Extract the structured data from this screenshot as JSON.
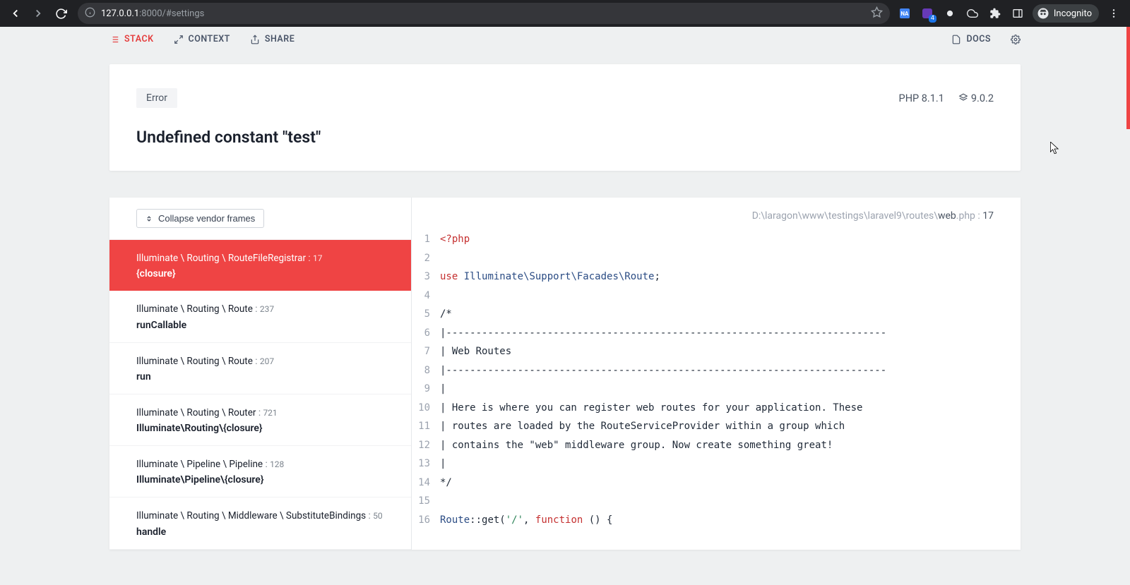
{
  "browser": {
    "url_host": "127.0.0.1",
    "url_port": ":8000",
    "url_path": "/#settings",
    "incognito_label": "Incognito",
    "ext_na_label": "NA",
    "ext_badge_num": "4"
  },
  "nav": {
    "stack": "STACK",
    "context": "CONTEXT",
    "share": "SHARE",
    "docs": "DOCS"
  },
  "header": {
    "error_tag": "Error",
    "php_version": "PHP 8.1.1",
    "laravel_version": "9.0.2",
    "title": "Undefined constant \"test\""
  },
  "stack": {
    "collapse_label": "Collapse vendor frames",
    "frames": [
      {
        "ns": "Illuminate \\ Routing \\ RouteFileRegistrar",
        "line": "17",
        "fn": "{closure}",
        "active": true
      },
      {
        "ns": "Illuminate \\ Routing \\ Route",
        "line": "237",
        "fn": "runCallable",
        "active": false
      },
      {
        "ns": "Illuminate \\ Routing \\ Route",
        "line": "207",
        "fn": "run",
        "active": false
      },
      {
        "ns": "Illuminate \\ Routing \\ Router",
        "line": "721",
        "fn": "Illuminate\\Routing\\{closure}",
        "active": false
      },
      {
        "ns": "Illuminate \\ Pipeline \\ Pipeline",
        "line": "128",
        "fn": "Illuminate\\Pipeline\\{closure}",
        "active": false
      },
      {
        "ns": "Illuminate \\ Routing \\ Middleware \\ SubstituteBindings",
        "line": "50",
        "fn": "handle",
        "active": false
      }
    ]
  },
  "code": {
    "path_pre": "D:\\laragon\\www\\testings\\laravel9\\routes\\",
    "file": "web",
    "ext": ".php",
    "line": "17",
    "lines": [
      {
        "n": "1",
        "html": "<span class='k-keyword'>&lt;?php</span>"
      },
      {
        "n": "2",
        "html": ""
      },
      {
        "n": "3",
        "html": "<span class='k-keyword'>use</span> <span class='k-class'>Illuminate\\Support\\Facades\\Route</span>;"
      },
      {
        "n": "4",
        "html": ""
      },
      {
        "n": "5",
        "html": "/*"
      },
      {
        "n": "6",
        "html": "|--------------------------------------------------------------------------"
      },
      {
        "n": "7",
        "html": "| Web Routes"
      },
      {
        "n": "8",
        "html": "|--------------------------------------------------------------------------"
      },
      {
        "n": "9",
        "html": "|"
      },
      {
        "n": "10",
        "html": "| Here is where you can register web routes for your application. These"
      },
      {
        "n": "11",
        "html": "| routes are loaded by the RouteServiceProvider within a group which"
      },
      {
        "n": "12",
        "html": "| contains the \"web\" middleware group. Now create something great!"
      },
      {
        "n": "13",
        "html": "|"
      },
      {
        "n": "14",
        "html": "*/"
      },
      {
        "n": "15",
        "html": ""
      },
      {
        "n": "16",
        "html": "<span class='k-class'>Route</span>::get(<span class='k-string'>'/'</span>, <span class='k-funcword'>function</span> () {"
      }
    ]
  }
}
